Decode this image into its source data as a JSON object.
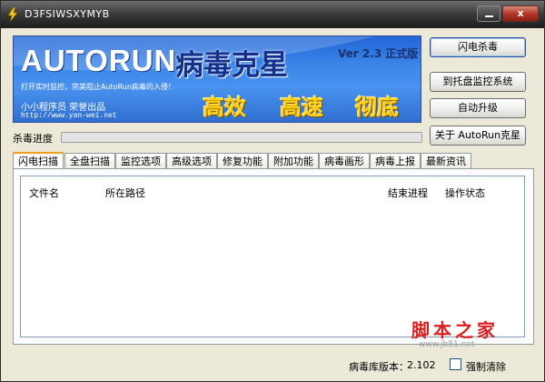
{
  "window": {
    "title": "D3FSIWSXYMYB",
    "close_glyph": "x"
  },
  "banner": {
    "brand": "AUTORUN",
    "subtitle": "病毒克星",
    "version": "Ver 2.3 正式版",
    "tagline": "打开实时监控，完美阻止AutoRun病毒的入侵！",
    "author": "小小程序员 荣誉出品",
    "url": "http://www.yan-wei.net",
    "slogans": [
      "高效",
      "高速",
      "彻底"
    ]
  },
  "buttons": {
    "quick_kill": "闪电杀毒",
    "tray_monitor": "到托盘监控系统",
    "auto_upgrade": "自动升级",
    "about": "关于 AutoRun克星"
  },
  "progress": {
    "label": "杀毒进度",
    "value": 0
  },
  "tabs": [
    "闪电扫描",
    "全盘扫描",
    "监控选项",
    "高级选项",
    "修复功能",
    "附加功能",
    "病毒画形",
    "病毒上报",
    "最新资讯"
  ],
  "table": {
    "columns": [
      "文件名",
      "所在路径",
      "结束进程",
      "操作状态"
    ]
  },
  "status": {
    "db_version_label": "病毒库版本：",
    "db_version": "2.102",
    "force_clear_label": "强制清除"
  },
  "watermark": {
    "text": "脚本之家",
    "url": "www.jb51.net"
  },
  "colors": {
    "banner": "#3b86e8",
    "slogan": "#ffd21a",
    "progress": "#3c8f3c",
    "tab_accent": "#f0a020"
  }
}
